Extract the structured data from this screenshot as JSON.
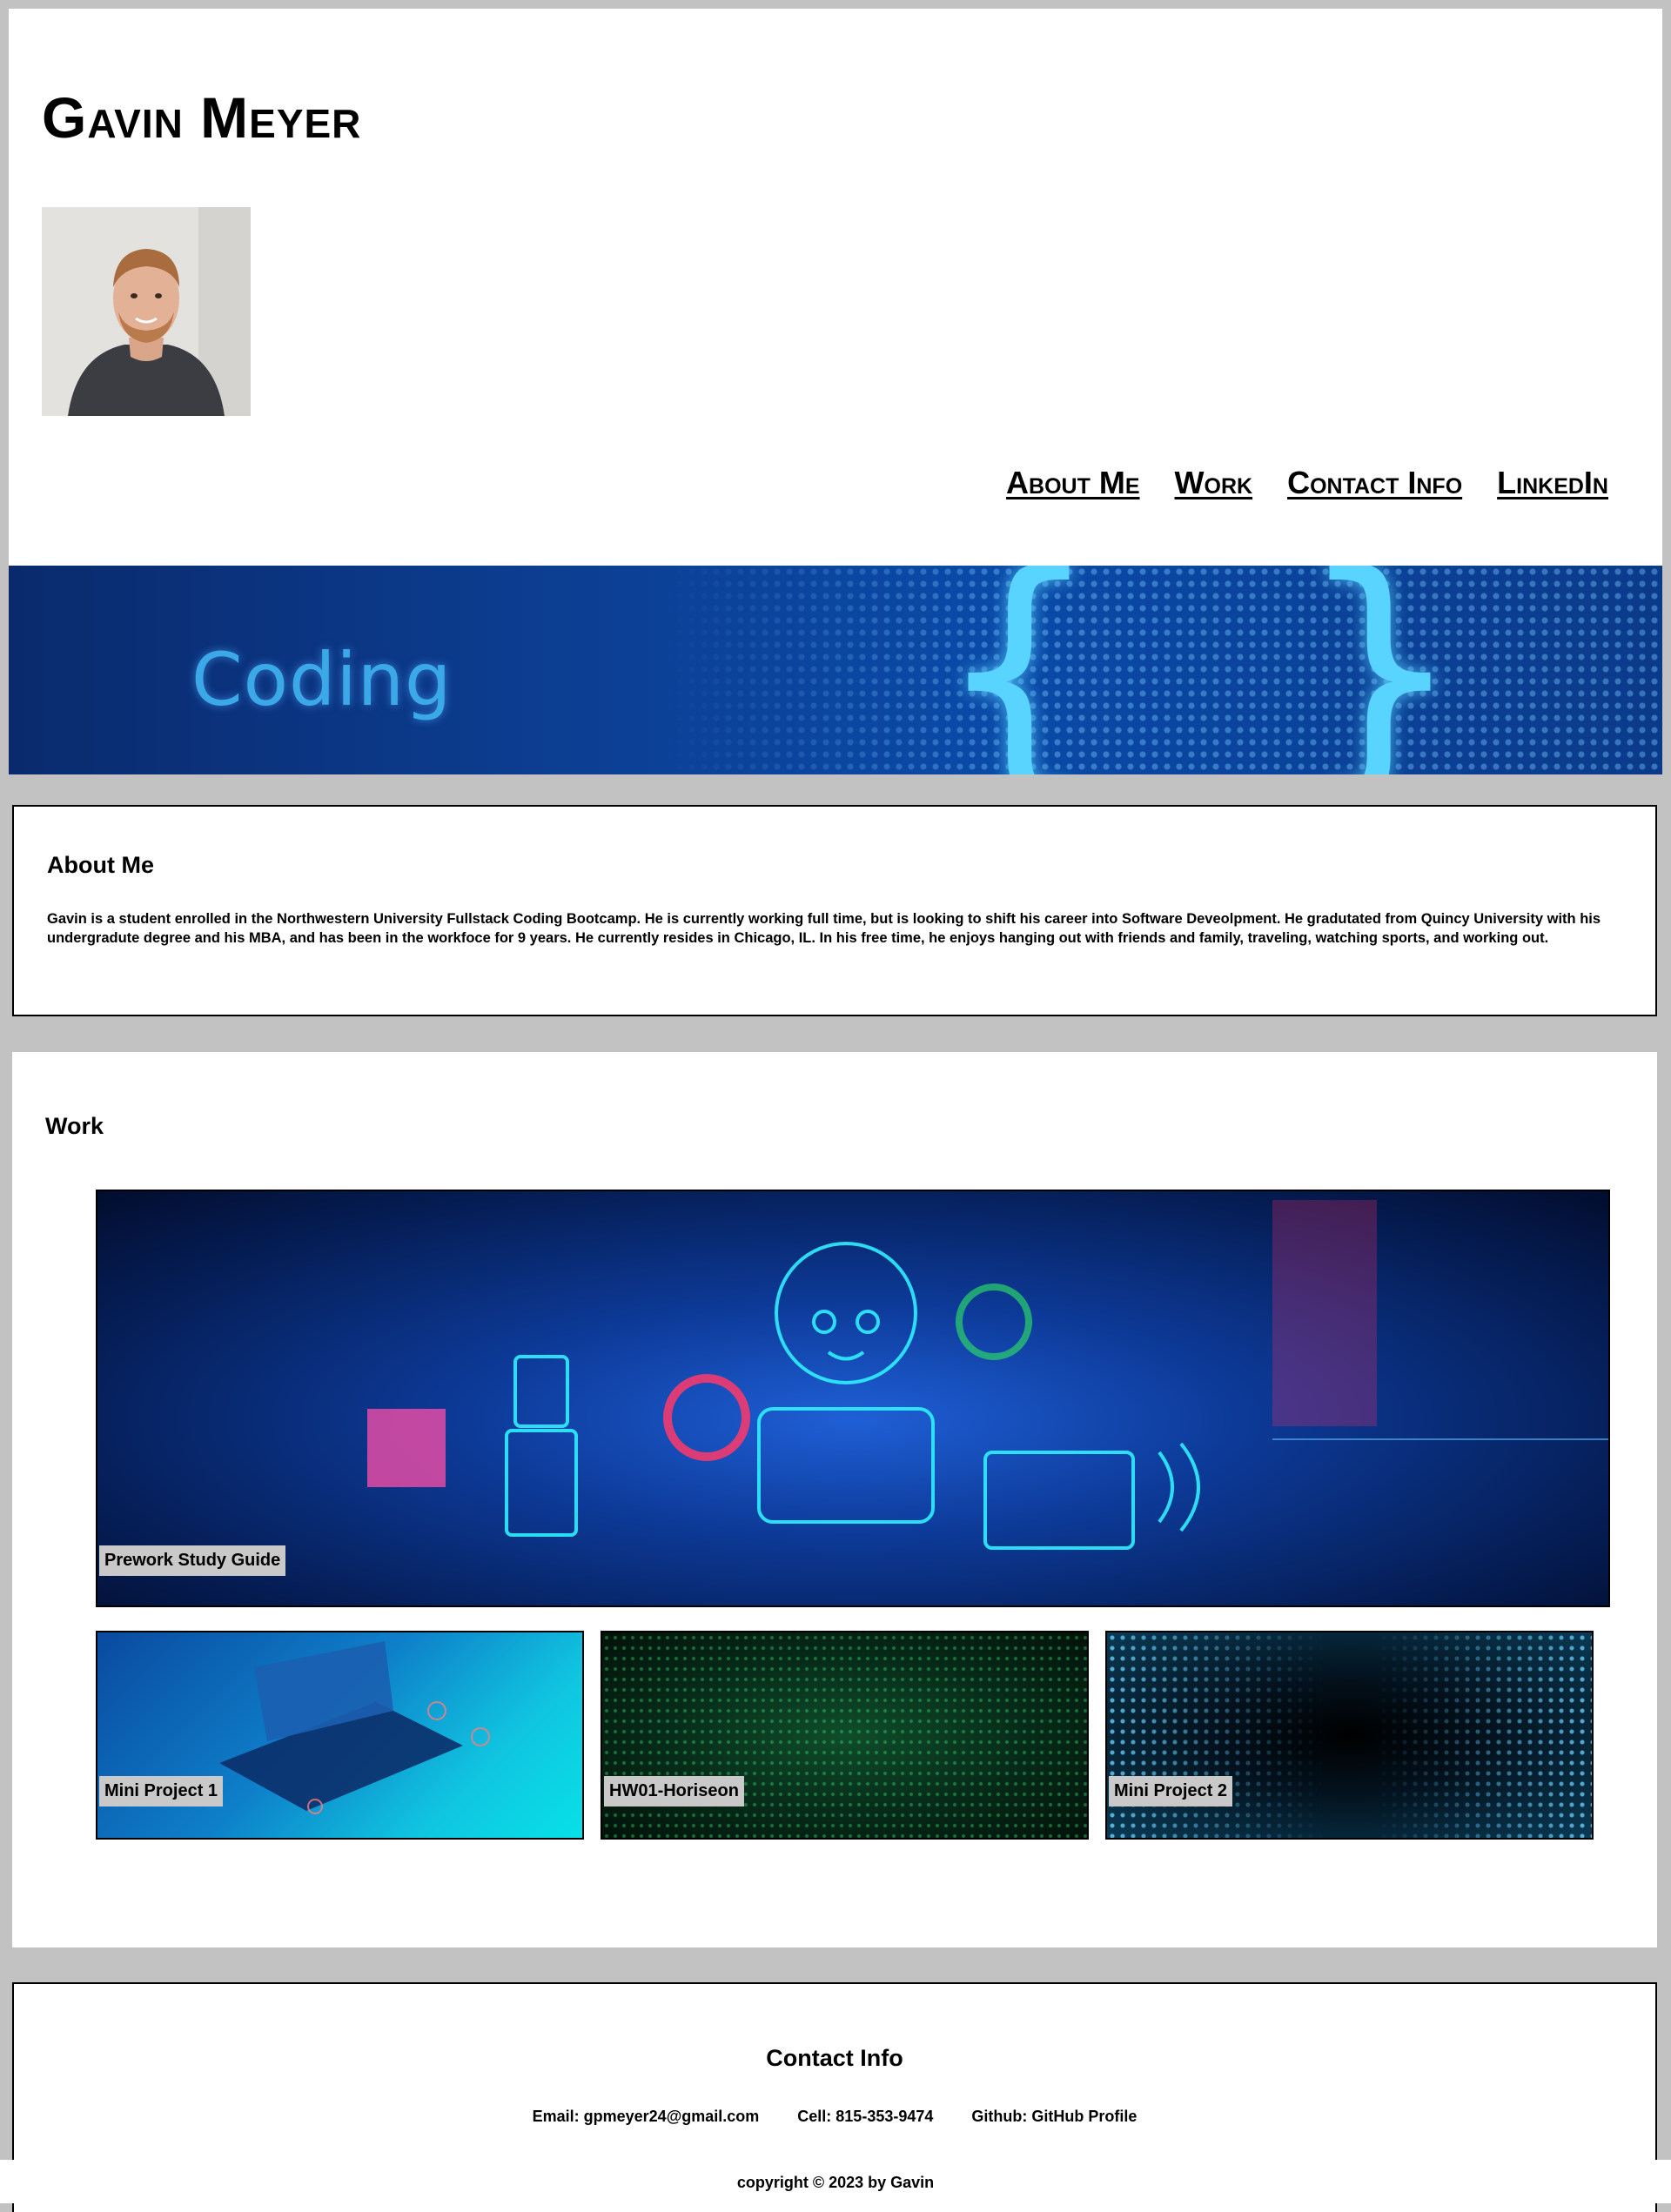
{
  "header": {
    "title": "Gavin Meyer",
    "portrait_alt": "Photo of Gavin Meyer"
  },
  "nav": {
    "items": [
      {
        "label": "About Me"
      },
      {
        "label": "Work"
      },
      {
        "label": "Contact Info"
      },
      {
        "label": "LinkedIn"
      }
    ]
  },
  "banner": {
    "word": "Coding",
    "braces": [
      "{",
      "}"
    ]
  },
  "about": {
    "heading": "About Me",
    "text": "Gavin is a student enrolled in the Northwestern University Fullstack Coding Bootcamp. He is currently working full time, but is looking to shift his career into Software Deveolpment. He gradutated from Quincy University with his undergradute degree and his MBA, and has been in the workfoce for 9 years. He currently resides in Chicago, IL. In his free time, he enjoys hanging out with friends and family, traveling, watching sports, and working out."
  },
  "work": {
    "heading": "Work",
    "projects": [
      {
        "label": "Prework Study Guide"
      },
      {
        "label": "Mini Project 1"
      },
      {
        "label": "HW01-Horiseon"
      },
      {
        "label": "Mini Project 2"
      }
    ]
  },
  "contact": {
    "heading": "Contact Info",
    "email": "Email: gpmeyer24@gmail.com",
    "cell": "Cell: 815-353-9474",
    "github": "Github: GitHub Profile"
  },
  "footer": {
    "copyright": "copyright © 2023 by Gavin"
  },
  "colors": {
    "page_background": "#c2c2c2",
    "section_background": "#ffffff",
    "label_background": "#c9c9c9",
    "banner_blue": "#0c3f94",
    "text": "#000000"
  }
}
